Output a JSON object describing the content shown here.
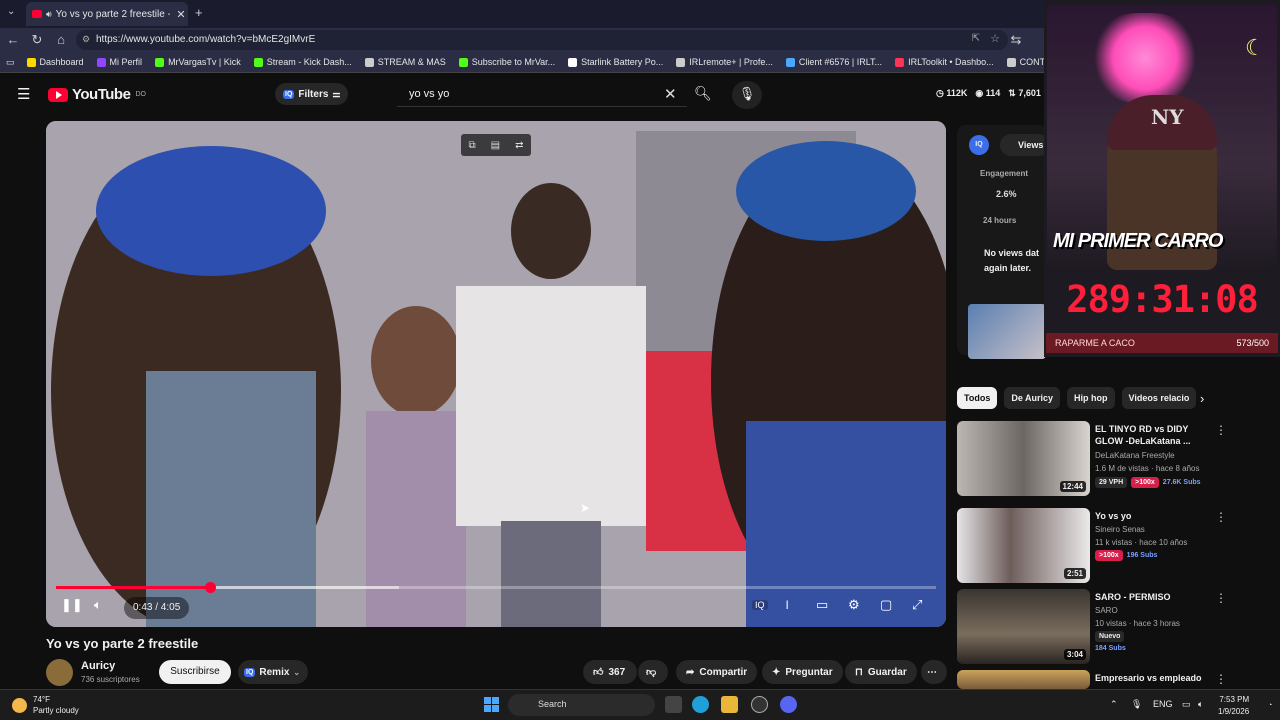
{
  "browser": {
    "tab_title": "Yo vs yo parte 2 freestile - You...",
    "url": "https://www.youtube.com/watch?v=bMcE2gIMvrE",
    "bookmarks": [
      {
        "label": "Dashboard",
        "color": "#ffd800"
      },
      {
        "label": "Mi Perfil",
        "color": "#9146ff"
      },
      {
        "label": "MrVargasTv | Kick",
        "color": "#53fc18"
      },
      {
        "label": "Stream - Kick Dash...",
        "color": "#53fc18"
      },
      {
        "label": "STREAM & MAS",
        "color": "#cccccc"
      },
      {
        "label": "Subscribe to MrVar...",
        "color": "#53fc18"
      },
      {
        "label": "Starlink Battery Po...",
        "color": "#ffffff"
      },
      {
        "label": "IRLremote+ | Profe...",
        "color": "#cccccc"
      },
      {
        "label": "Client #6576 | IRLT...",
        "color": "#4aa8ff"
      },
      {
        "label": "IRLToolkit • Dashbo...",
        "color": "#ff3355"
      },
      {
        "label": "CONTADOR",
        "color": "#cccccc"
      }
    ]
  },
  "youtube": {
    "logo": "YouTube",
    "country": "DO",
    "filters_label": "Filters",
    "iq_badge": "IQ",
    "search_value": "yo vs yo",
    "stats": {
      "views": "112K",
      "likes": "114",
      "other": "7,601"
    }
  },
  "player": {
    "current_time": "0:43",
    "duration": "4:05",
    "time_display": "0:43 / 4:05",
    "progress_fraction": 0.175,
    "buffered_fraction": 0.39
  },
  "video": {
    "title": "Yo vs yo parte 2 freestile",
    "channel": "Auricy",
    "subscribers": "736 suscriptores",
    "subscribe_label": "Suscribirse",
    "remix_label": "Remix",
    "likes": "367",
    "share_label": "Compartir",
    "ask_label": "Preguntar",
    "save_label": "Guardar"
  },
  "iq_panel": {
    "views_tab": "Views",
    "engagement_label": "Engagement",
    "engagement_value": "2.6%",
    "period": "24 hours",
    "no_data": "No views dat again later."
  },
  "chips": [
    "Todos",
    "De Auricy",
    "Hip hop",
    "Videos relacio"
  ],
  "recommendations": [
    {
      "title": "EL TINYO RD vs DIDY GLOW -DeLaKatana ...",
      "channel": "DeLaKatana Freestyle",
      "meta": "1.6 M de vistas · hace 8 años",
      "duration": "12:44",
      "badges": {
        "vph": "29 VPH",
        "outlier": ">100x",
        "subs": "27.6K Subs"
      }
    },
    {
      "title": "Yo vs yo",
      "channel": "Sineiro Senas",
      "meta": "11 k vistas · hace 10 años",
      "duration": "2:51",
      "badges": {
        "vph": "",
        "outlier": ">100x",
        "subs": "196 Subs"
      }
    },
    {
      "title": "SARO - PERMISO",
      "channel": "SARO",
      "meta": "10 vistas · hace 3 horas",
      "duration": "3:04",
      "badges": {
        "vph": "Nuevo",
        "outlier": "",
        "subs": "184 Subs"
      }
    },
    {
      "title": "Empresario vs empleado",
      "channel": "",
      "meta": "",
      "duration": "",
      "badges": {
        "vph": "",
        "outlier": "",
        "subs": ""
      }
    }
  ],
  "overlay": {
    "cap_logo": "NY",
    "banner": "MI PRIMER CARRO",
    "timer": "289:31:08",
    "goal_label": "RAPARME A CACO",
    "goal_value": "573/500",
    "goal_fraction": 1.0
  },
  "taskbar": {
    "temperature": "74°F",
    "weather": "Partly cloudy",
    "search_label": "Search",
    "lang": "ENG",
    "time": "7:53 PM",
    "date": "1/9/2026"
  }
}
